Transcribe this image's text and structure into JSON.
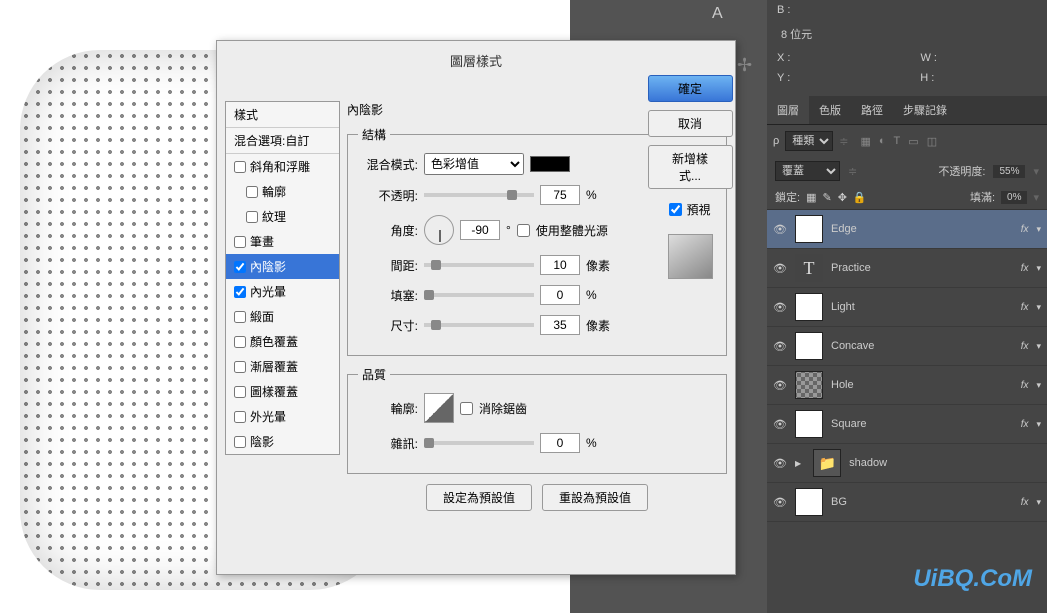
{
  "dialog": {
    "title": "圖層樣式",
    "styles_header": "樣式",
    "blend_options": "混合選項:自訂",
    "items": [
      "斜角和浮雕",
      "輪廓",
      "紋理",
      "筆畫",
      "內陰影",
      "內光暈",
      "緞面",
      "顏色覆蓋",
      "漸層覆蓋",
      "圖樣覆蓋",
      "外光暈",
      "陰影"
    ],
    "checked": [
      false,
      false,
      false,
      false,
      true,
      true,
      false,
      false,
      false,
      false,
      false,
      false
    ],
    "content_title": "內陰影",
    "structure_label": "結構",
    "blend_mode_label": "混合模式:",
    "blend_mode_value": "色彩增值",
    "opacity_label": "不透明:",
    "opacity_value": "75",
    "opacity_unit": "%",
    "angle_label": "角度:",
    "angle_value": "-90",
    "angle_unit": "°",
    "global_light": "使用整體光源",
    "distance_label": "間距:",
    "distance_value": "10",
    "distance_unit": "像素",
    "choke_label": "填塞:",
    "choke_value": "0",
    "choke_unit": "%",
    "size_label": "尺寸:",
    "size_value": "35",
    "size_unit": "像素",
    "quality_label": "品質",
    "contour_label": "輪廓:",
    "antialias": "消除鋸齒",
    "noise_label": "雜訊:",
    "noise_value": "0",
    "noise_unit": "%",
    "set_default": "設定為預設值",
    "reset_default": "重設為預設值",
    "ok": "確定",
    "cancel": "取消",
    "new_style": "新增樣式...",
    "preview": "預視"
  },
  "info": {
    "bit_depth": "8 位元",
    "x_label": "X :",
    "y_label": "Y :",
    "w_label": "W :",
    "h_label": "H :"
  },
  "panels": {
    "tabs": [
      "圖層",
      "色版",
      "路徑",
      "步驟記錄"
    ],
    "kind_label": "種類",
    "mode": "覆蓋",
    "opacity_label": "不透明度:",
    "opacity_value": "55%",
    "lock_label": "鎖定:",
    "fill_label": "填滿:",
    "fill_value": "0%"
  },
  "layers": [
    {
      "name": "Edge",
      "fx": true,
      "selected": true,
      "thumb": "white"
    },
    {
      "name": "Practice",
      "fx": true,
      "thumb": "type"
    },
    {
      "name": "Light",
      "fx": true,
      "thumb": "white"
    },
    {
      "name": "Concave",
      "fx": true,
      "thumb": "white"
    },
    {
      "name": "Hole",
      "fx": true,
      "thumb": "checker"
    },
    {
      "name": "Square",
      "fx": true,
      "thumb": "white"
    },
    {
      "name": "shadow",
      "fx": false,
      "thumb": "folder"
    },
    {
      "name": "BG",
      "fx": true,
      "thumb": "white"
    }
  ],
  "watermark": "UiBQ.CoM"
}
